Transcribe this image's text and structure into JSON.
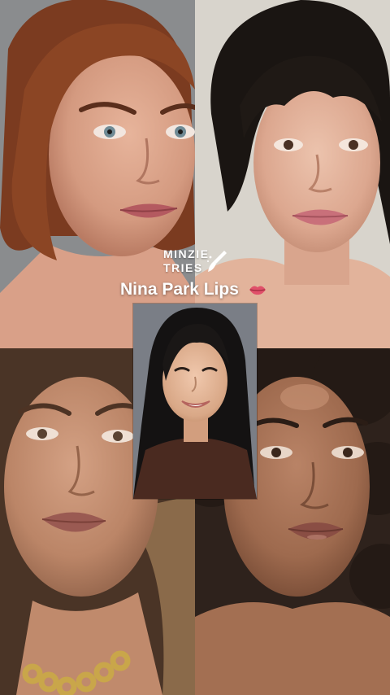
{
  "brand": {
    "line1": "MINZIE",
    "line2": "TRIES"
  },
  "title": {
    "text": "Nina Park Lips",
    "emoji": "lips-icon"
  },
  "colors": {
    "text": "#ffffff",
    "lip_emoji": "#e0506a"
  },
  "tiles": [
    {
      "name": "top-left-photo",
      "subject": "woman with auburn bob and mauve lips"
    },
    {
      "name": "top-right-photo",
      "subject": "woman with dark updo and pink lips"
    },
    {
      "name": "bottom-left-photo",
      "subject": "woman with brown hair and gold chain necklace"
    },
    {
      "name": "bottom-right-photo",
      "subject": "woman with dark curly hair and glossy lips"
    },
    {
      "name": "creator-inset-video",
      "subject": "creator with long dark hair in brown top"
    }
  ]
}
